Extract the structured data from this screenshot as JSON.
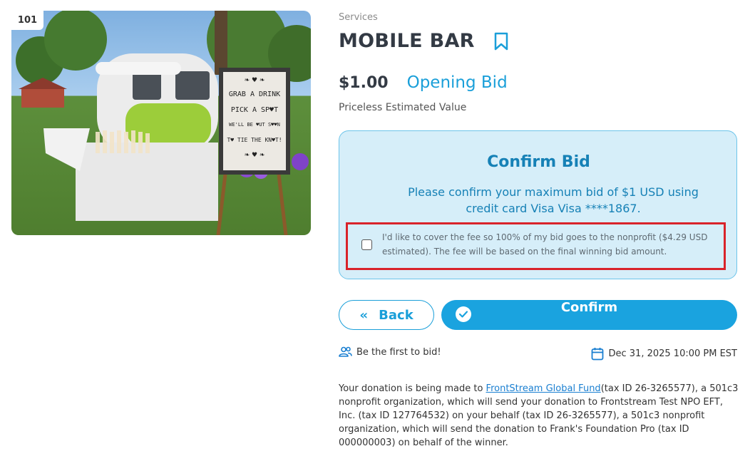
{
  "item": {
    "lot_number": "101",
    "category": "Services",
    "title": "MOBILE BAR",
    "price": "$1.00",
    "price_label": "Opening Bid",
    "estimated_value": "Priceless Estimated Value"
  },
  "photo": {
    "sign_lines": [
      "GRAB A DRINK",
      "PICK A SP♥T",
      "WE'LL BE ♥UT S♥♥N",
      "T♥ TIE THE KN♥T!"
    ]
  },
  "confirm_panel": {
    "title": "Confirm Bid",
    "message": "Please confirm your maximum bid of $1 USD using credit card Visa Visa ****1867.",
    "fee_checkbox_checked": false,
    "fee_text": "I'd like to cover the fee so 100% of my bid goes to the nonprofit ($4.29 USD estimated). The fee will be based on the final winning bid amount."
  },
  "actions": {
    "back_label": "Back",
    "confirm_label": "Confirm"
  },
  "meta": {
    "bidders_text": "Be the first to bid!",
    "end_date": "Dec 31, 2025 10:00 PM EST"
  },
  "disclaimer": {
    "prefix": "Your donation is being made to ",
    "link_text": "FrontStream Global Fund",
    "suffix": "(tax ID 26-3265577), a 501c3 nonprofit organization, which will send your donation to Frontstream Test NPO EFT, Inc. (tax ID 127764532) on your behalf (tax ID 26-3265577), a 501c3 nonprofit organization, which will send the donation to Frank's Foundation Pro (tax ID 000000003) on behalf of the winner."
  },
  "colors": {
    "accent": "#1aa3df",
    "panel_bg": "#d6eef9",
    "highlight": "#d9232a"
  }
}
